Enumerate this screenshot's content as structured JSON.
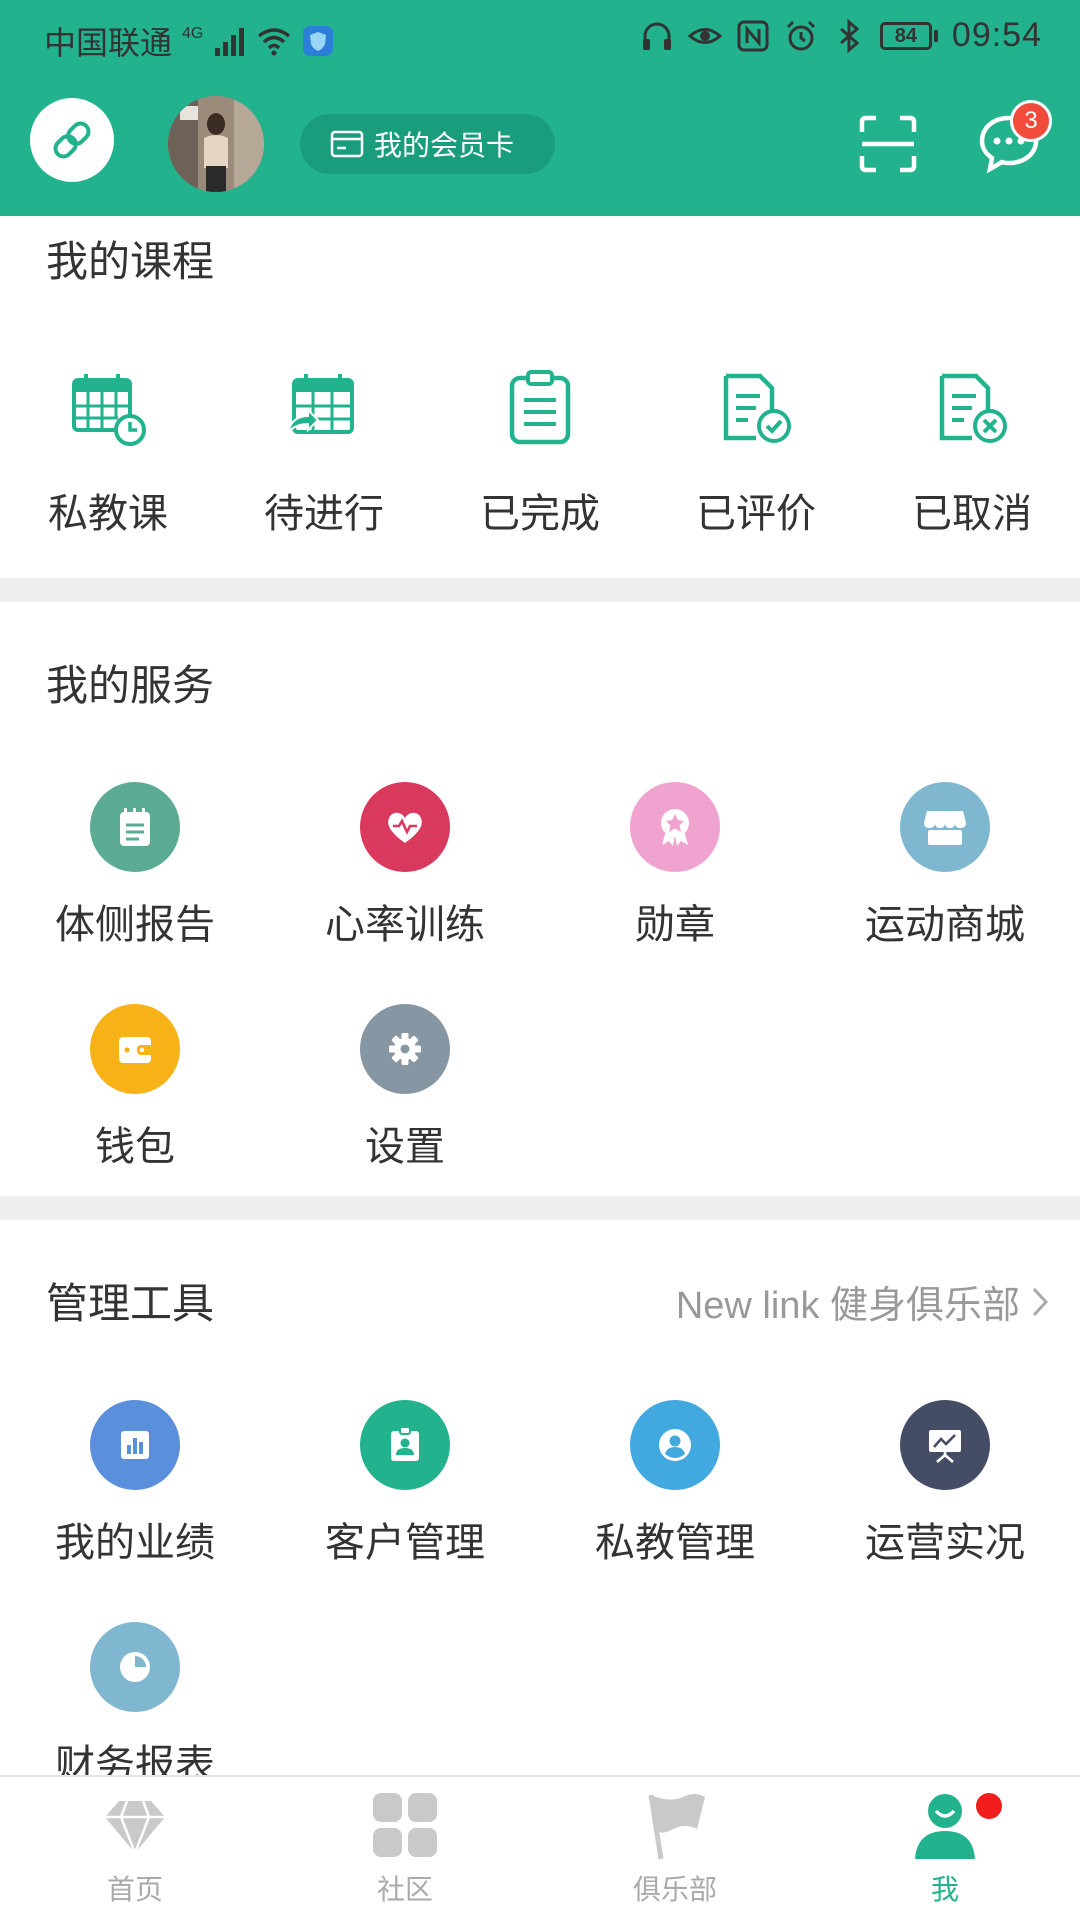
{
  "status_bar": {
    "carrier": "中国联通",
    "network": "4G",
    "battery": "84",
    "time": "09:54"
  },
  "header": {
    "member_card_label": "我的会员卡",
    "message_badge": "3"
  },
  "courses": {
    "title": "我的课程",
    "items": [
      {
        "label": "私教课",
        "icon": "calendar-clock-icon"
      },
      {
        "label": "待进行",
        "icon": "calendar-arrow-icon"
      },
      {
        "label": "已完成",
        "icon": "clipboard-list-icon"
      },
      {
        "label": "已评价",
        "icon": "document-check-icon"
      },
      {
        "label": "已取消",
        "icon": "document-cancel-icon"
      }
    ]
  },
  "services": {
    "title": "我的服务",
    "items": [
      {
        "label": "体侧报告",
        "icon": "notepad-icon",
        "color": "#5bab94"
      },
      {
        "label": "心率训练",
        "icon": "heart-pulse-icon",
        "color": "#d8395c"
      },
      {
        "label": "勋章",
        "icon": "medal-icon",
        "color": "#f0a3cf"
      },
      {
        "label": "运动商城",
        "icon": "shop-icon",
        "color": "#7fb7d1"
      },
      {
        "label": "钱包",
        "icon": "wallet-icon",
        "color": "#f7b217"
      },
      {
        "label": "设置",
        "icon": "gear-icon",
        "color": "#8796a3"
      }
    ]
  },
  "tools": {
    "title": "管理工具",
    "club_link": "New link 健身俱乐部",
    "items": [
      {
        "label": "我的业绩",
        "icon": "bar-chart-icon",
        "color": "#5a8fdb"
      },
      {
        "label": "客户管理",
        "icon": "id-badge-icon",
        "color": "#22b38e"
      },
      {
        "label": "私教管理",
        "icon": "user-circle-icon",
        "color": "#41a8e0"
      },
      {
        "label": "运营实况",
        "icon": "presentation-icon",
        "color": "#444c66"
      },
      {
        "label": "财务报表",
        "icon": "pie-chart-icon",
        "color": "#7fb7d1"
      }
    ]
  },
  "bottom_nav": {
    "items": [
      {
        "label": "首页",
        "icon": "diamond-icon"
      },
      {
        "label": "社区",
        "icon": "grid-icon"
      },
      {
        "label": "俱乐部",
        "icon": "flag-icon"
      },
      {
        "label": "我",
        "icon": "person-icon"
      }
    ],
    "active": "我"
  },
  "colors": {
    "brand": "#22b38e",
    "badge": "#f04b3b"
  }
}
